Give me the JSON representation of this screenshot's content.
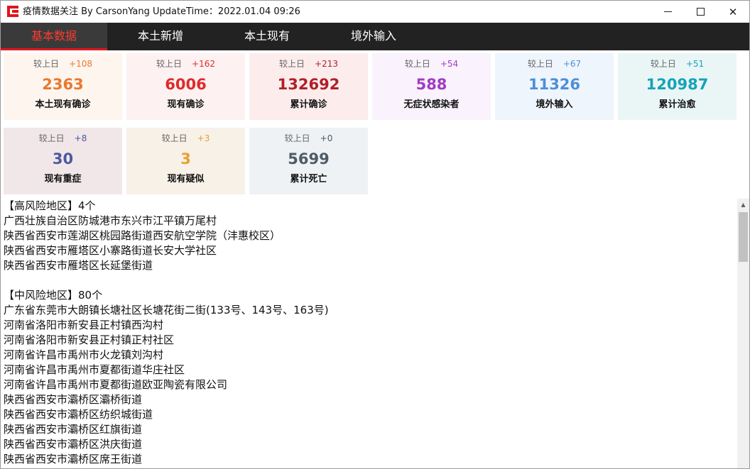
{
  "window": {
    "title": "疫情数据关注 By CarsonYang  UpdateTime：2022.01.04 09:26",
    "icon": "app-logo-icon",
    "controls": {
      "minimize": "minimize-icon",
      "maximize": "maximize-icon",
      "close": "✕"
    }
  },
  "tabs": [
    {
      "label": "基本数据",
      "active": true
    },
    {
      "label": "本土新增",
      "active": false
    },
    {
      "label": "本土现有",
      "active": false
    },
    {
      "label": "境外输入",
      "active": false
    }
  ],
  "cards": [
    {
      "delta_label": "较上日",
      "delta": "+108",
      "value": "2363",
      "label": "本土现有确诊",
      "color": "#e8792e",
      "delta_color": "#e8792e",
      "bg": "#fef5ef"
    },
    {
      "delta_label": "较上日",
      "delta": "+162",
      "value": "6006",
      "label": "现有确诊",
      "color": "#e02a2a",
      "delta_color": "#e02a2a",
      "bg": "#fdf1f1"
    },
    {
      "delta_label": "较上日",
      "delta": "+213",
      "value": "132692",
      "label": "累计确诊",
      "color": "#b0202a",
      "delta_color": "#b0202a",
      "bg": "#fcecec"
    },
    {
      "delta_label": "较上日",
      "delta": "+54",
      "value": "588",
      "label": "无症状感染者",
      "color": "#a23cc2",
      "delta_color": "#a23cc2",
      "bg": "#faf3fd"
    },
    {
      "delta_label": "较上日",
      "delta": "+67",
      "value": "11326",
      "label": "境外输入",
      "color": "#4d8fd9",
      "delta_color": "#4d8fd9",
      "bg": "#eff5fd"
    },
    {
      "delta_label": "较上日",
      "delta": "+51",
      "value": "120987",
      "label": "累计治愈",
      "color": "#17a2b8",
      "delta_color": "#17a2b8",
      "bg": "#eaf6f6"
    },
    {
      "delta_label": "较上日",
      "delta": "+8",
      "value": "30",
      "label": "现有重症",
      "color": "#4b5a9e",
      "delta_color": "#4b5a9e",
      "bg": "#f1e7e9"
    },
    {
      "delta_label": "较上日",
      "delta": "+3",
      "value": "3",
      "label": "现有疑似",
      "color": "#e8a02e",
      "delta_color": "#e8a02e",
      "bg": "#f7f1e8"
    },
    {
      "delta_label": "较上日",
      "delta": "+0",
      "value": "5699",
      "label": "累计死亡",
      "color": "#4f5b66",
      "delta_color": "#4f5b66",
      "bg": "#eff2f5"
    }
  ],
  "risk_list": [
    "【高风险地区】4个",
    "广西壮族自治区防城港市东兴市江平镇万尾村",
    "陕西省西安市莲湖区桃园路街道西安航空学院（沣惠校区）",
    "陕西省西安市雁塔区小寨路街道长安大学社区",
    "陕西省西安市雁塔区长延堡街道",
    "",
    "【中风险地区】80个",
    "广东省东莞市大朗镇长塘社区长塘花街二街(133号、143号、163号)",
    "河南省洛阳市新安县正村镇西沟村",
    "河南省洛阳市新安县正村镇正村社区",
    "河南省许昌市禹州市火龙镇刘沟村",
    "河南省许昌市禹州市夏都街道华庄社区",
    "河南省许昌市禹州市夏都街道欧亚陶瓷有限公司",
    "陕西省西安市灞桥区灞桥街道",
    "陕西省西安市灞桥区纺织城街道",
    "陕西省西安市灞桥区红旗街道",
    "陕西省西安市灞桥区洪庆街道",
    "陕西省西安市灞桥区席王街道"
  ],
  "scrollbar": {
    "up_arrow": "▲"
  }
}
